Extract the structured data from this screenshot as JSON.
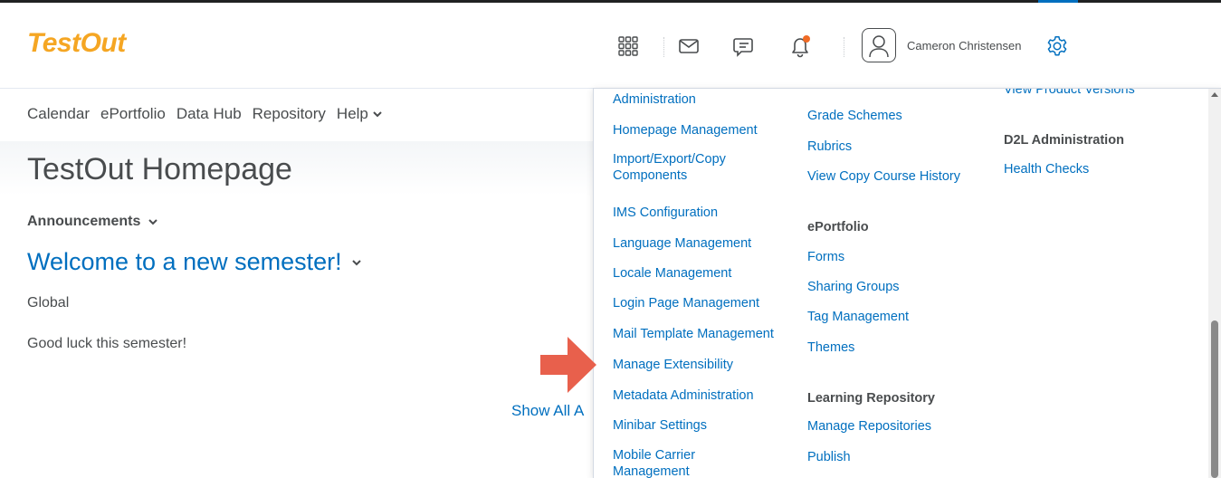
{
  "header": {
    "logo": "TestOut",
    "username": "Cameron Christensen"
  },
  "nav": {
    "items": [
      "Calendar",
      "ePortfolio",
      "Data Hub",
      "Repository",
      "Help"
    ]
  },
  "page": {
    "title": "TestOut Homepage",
    "announcements_label": "Announcements",
    "announcement_title": "Welcome to a new semester!",
    "audience": "Global",
    "body": "Good luck this semester!",
    "show_all": "Show All A"
  },
  "admin_menu": {
    "col1": [
      "Administration",
      "Homepage Management",
      "Import/Export/Copy Components",
      "IMS Configuration",
      "Language Management",
      "Locale Management",
      "Login Page Management",
      "Mail Template Management",
      "Manage Extensibility",
      "Metadata Administration",
      "Minibar Settings",
      "Mobile Carrier Management"
    ],
    "col2": {
      "links_top": [
        "Grade Schemes",
        "Rubrics",
        "View Copy Course History"
      ],
      "eportfolio_heading": "ePortfolio",
      "eportfolio_links": [
        "Forms",
        "Sharing Groups",
        "Tag Management",
        "Themes"
      ],
      "repo_heading": "Learning Repository",
      "repo_links": [
        "Manage Repositories",
        "Publish"
      ]
    },
    "col3": {
      "cut_link": "View Product Versions",
      "d2l_heading": "D2L Administration",
      "d2l_links": [
        "Health Checks"
      ]
    }
  },
  "icons": {
    "grid": "apps-grid-icon",
    "mail": "mail-icon",
    "chat": "chat-icon",
    "bell": "bell-icon",
    "gear": "gear-icon"
  },
  "colors": {
    "accent": "#006fbf",
    "logo": "#f5a623",
    "notification": "#f06b25",
    "pointer_arrow": "#e8604c"
  }
}
